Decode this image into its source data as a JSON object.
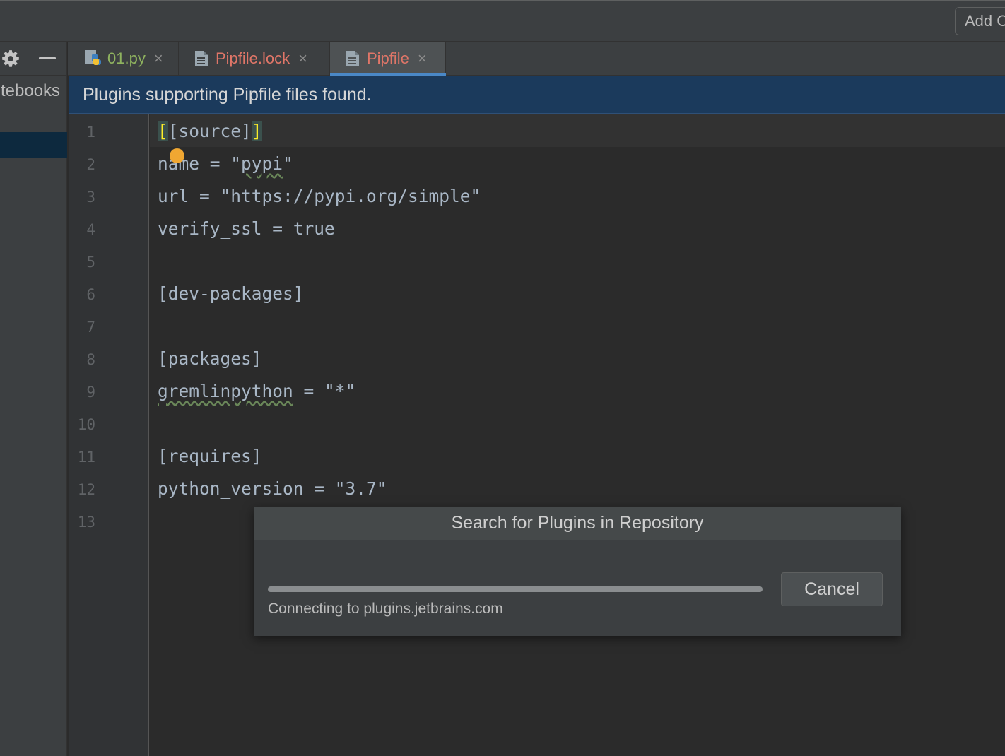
{
  "toolbar": {
    "add_button_label": "Add C"
  },
  "sidebar": {
    "partial_label": "tebooks"
  },
  "tabs": [
    {
      "label": "01.py",
      "icon": "python-file-icon"
    },
    {
      "label": "Pipfile.lock",
      "icon": "text-file-icon"
    },
    {
      "label": "Pipfile",
      "icon": "text-file-icon",
      "active": true
    }
  ],
  "tab_close_glyph": "×",
  "banner": {
    "text": "Plugins supporting Pipfile files found."
  },
  "editor": {
    "line_numbers": [
      "1",
      "2",
      "3",
      "4",
      "5",
      "6",
      "7",
      "8",
      "9",
      "10",
      "11",
      "12",
      "13"
    ],
    "lines": [
      "[[source]]",
      "name = \"pypi\"",
      "url = \"https://pypi.org/simple\"",
      "verify_ssl = true",
      "",
      "[dev-packages]",
      "",
      "[packages]",
      "gremlinpython = \"*\"",
      "",
      "[requires]",
      "python_version = \"3.7\"",
      ""
    ]
  },
  "dialog": {
    "title": "Search for Plugins in Repository",
    "status": "Connecting to plugins.jetbrains.com",
    "cancel_label": "Cancel",
    "progress_fraction": 1.0
  },
  "colors": {
    "banner_bg": "#1b3a5c",
    "active_tab_underline": "#4a88c7",
    "modified_file_label": "#e07668",
    "python_file_label": "#8fb35f",
    "bracket_highlight": "#ffef28",
    "intention_bulb": "#f0a732"
  }
}
